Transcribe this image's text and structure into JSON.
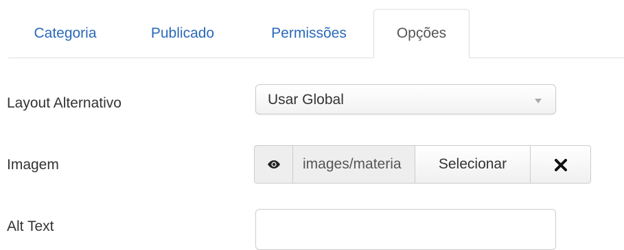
{
  "tabs": [
    {
      "label": "Categoria",
      "active": false
    },
    {
      "label": "Publicado",
      "active": false
    },
    {
      "label": "Permissões",
      "active": false
    },
    {
      "label": "Opções",
      "active": true
    }
  ],
  "form": {
    "layout": {
      "label": "Layout Alternativo",
      "value": "Usar Global"
    },
    "image": {
      "label": "Imagem",
      "preview_icon": "eye-icon",
      "value": "images/materia",
      "select_label": "Selecionar",
      "clear_icon": "close-icon"
    },
    "alt_text": {
      "label": "Alt Text",
      "value": ""
    }
  },
  "colors": {
    "link": "#2a69b8",
    "active_tab_text": "#555555",
    "border": "#cccccc"
  }
}
